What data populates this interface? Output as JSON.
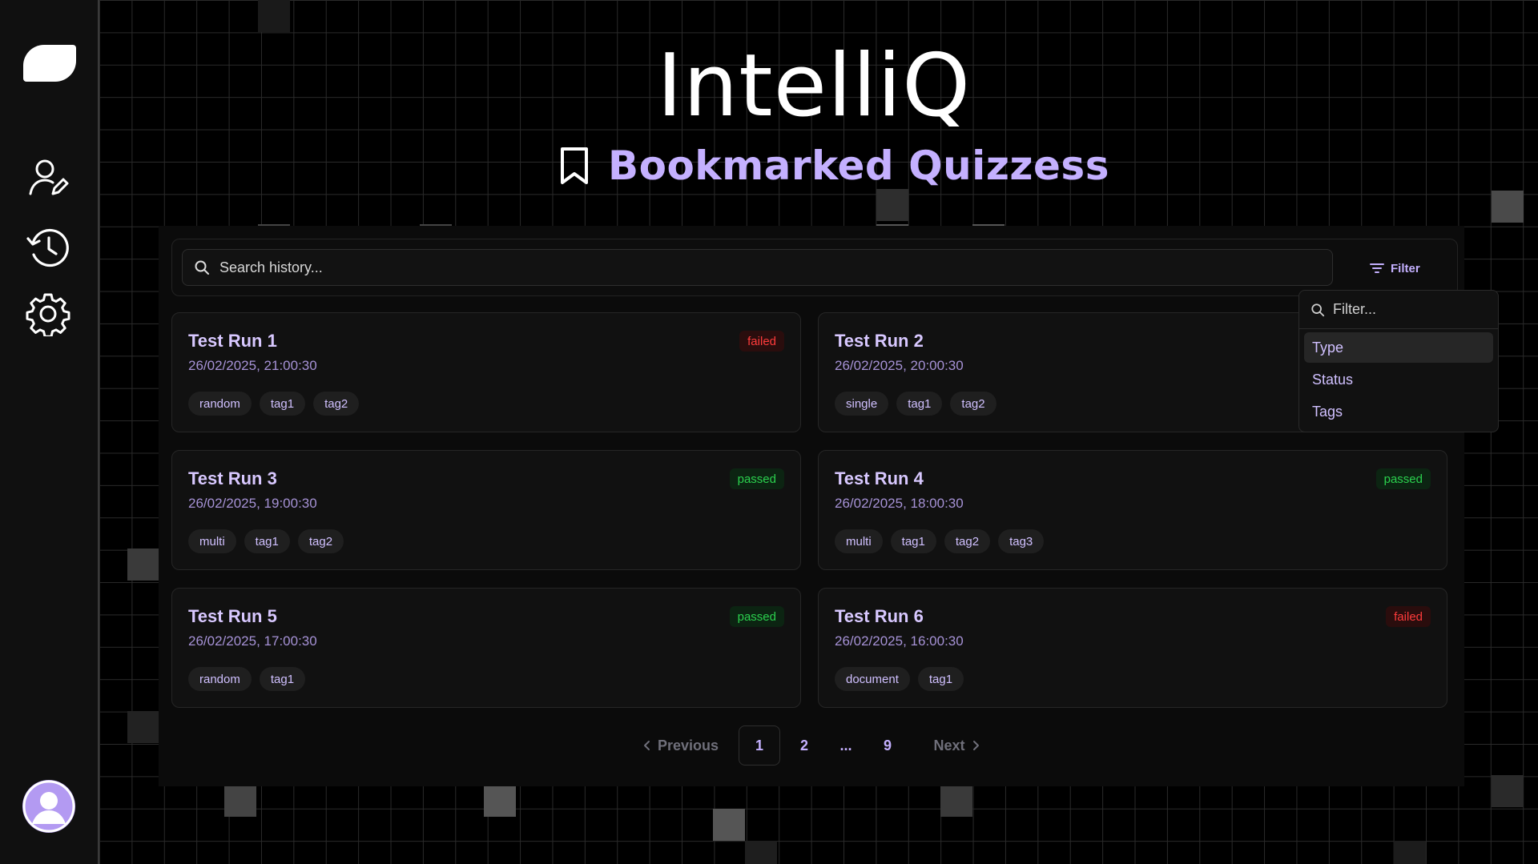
{
  "brand": {
    "name": "IntelliQ"
  },
  "header": {
    "title": "Bookmarked Quizzess"
  },
  "sidebar": {
    "items": [
      {
        "icon": "user-edit-icon"
      },
      {
        "icon": "history-icon"
      },
      {
        "icon": "gear-icon"
      }
    ]
  },
  "search": {
    "placeholder": "Search history...",
    "value": ""
  },
  "filter": {
    "label": "Filter",
    "search_placeholder": "Filter...",
    "options": [
      "Type",
      "Status",
      "Tags"
    ],
    "active_option": "Type"
  },
  "cards": [
    {
      "title": "Test Run 1",
      "date": "26/02/2025, 21:00:30",
      "status": "failed",
      "tags": [
        "random",
        "tag1",
        "tag2"
      ]
    },
    {
      "title": "Test Run 2",
      "date": "26/02/2025, 20:00:30",
      "status": "",
      "tags": [
        "single",
        "tag1",
        "tag2"
      ]
    },
    {
      "title": "Test Run 3",
      "date": "26/02/2025, 19:00:30",
      "status": "passed",
      "tags": [
        "multi",
        "tag1",
        "tag2"
      ]
    },
    {
      "title": "Test Run 4",
      "date": "26/02/2025, 18:00:30",
      "status": "passed",
      "tags": [
        "multi",
        "tag1",
        "tag2",
        "tag3"
      ]
    },
    {
      "title": "Test Run 5",
      "date": "26/02/2025, 17:00:30",
      "status": "passed",
      "tags": [
        "random",
        "tag1"
      ]
    },
    {
      "title": "Test Run 6",
      "date": "26/02/2025, 16:00:30",
      "status": "failed",
      "tags": [
        "document",
        "tag1"
      ]
    }
  ],
  "pagination": {
    "previous": "Previous",
    "next": "Next",
    "pages": [
      "1",
      "2",
      "...",
      "9"
    ],
    "current": "1"
  },
  "colors": {
    "accent": "#c4b0ff",
    "failed": "#ff3b3b",
    "passed": "#2bd14e"
  }
}
